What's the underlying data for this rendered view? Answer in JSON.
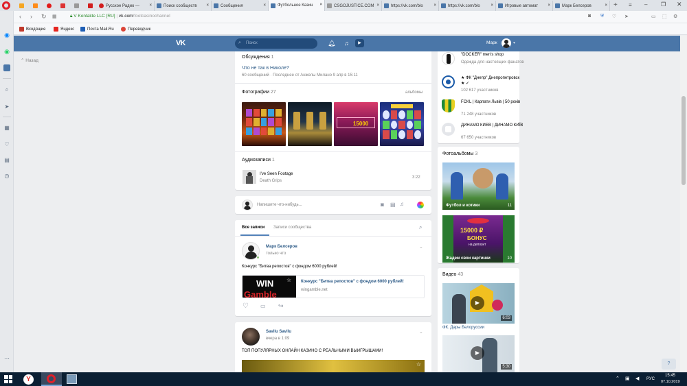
{
  "browser": {
    "tabs": [
      {
        "label": "Русское Радио —",
        "color": "#d21e1e"
      },
      {
        "label": "Поиск сообществ",
        "color": "#4a76a8"
      },
      {
        "label": "Сообщения",
        "color": "#4a76a8"
      },
      {
        "label": "Футбольное Казин",
        "color": "#4a76a8"
      },
      {
        "label": "CSGOJUSTICE.COM",
        "color": "#999999"
      },
      {
        "label": "https://vk.com/blo",
        "color": "#4a76a8"
      },
      {
        "label": "https://vk.com/blo",
        "color": "#4a76a8"
      },
      {
        "label": "Игровые автомат",
        "color": "#4a76a8"
      },
      {
        "label": "Марк Белсеров",
        "color": "#4a76a8"
      }
    ],
    "url_site": "V Kontakte LLC [RU]",
    "url_host": "vk.com",
    "url_path": "/footcasinochannel",
    "bookmarks": [
      {
        "label": "Входящие",
        "color": "#c0392b"
      },
      {
        "label": "Яндекс",
        "color": "#e52620"
      },
      {
        "label": "Почта Mail.Ru",
        "color": "#1f5fb5"
      },
      {
        "label": "Переводчик",
        "color": "#db4437"
      }
    ]
  },
  "vk": {
    "search_placeholder": "Поиск",
    "user_name": "Марк",
    "back_label": "Назад"
  },
  "discussions": {
    "title": "Обсуждения",
    "count": "1",
    "topic": "Что не так в Николе?",
    "meta": "60 сообщений · Последнее от Анжелы Милано 9 апр в 15:11"
  },
  "photos": {
    "title": "Фотографии",
    "count": "27",
    "albums_link": "альбомы",
    "banner_text": "15000"
  },
  "audio": {
    "title": "Аудиозаписи",
    "count": "1",
    "track": "I've Seen Footage",
    "artist": "Death Grips",
    "duration": "3:22"
  },
  "composer": {
    "placeholder": "Напишите что-нибудь..."
  },
  "wall_tabs": {
    "all": "Все записи",
    "community": "Записи сообщества"
  },
  "post1": {
    "author": "Марк Белсеров",
    "time": "только что",
    "text": "Конкурс \"Битва репостов\" с фондом 6000 рублей!",
    "link_title": "Конкурс \"Битва репостов\" с фондом 6000 рублей!",
    "link_host": "wingamble.net",
    "thumb_line1": "WIN",
    "thumb_line2": "Gamble"
  },
  "post2": {
    "author": "Savilu Savilu",
    "time": "вчера в 1:09",
    "text": "ТОП ПОПУЛЯРНЫХ ОНЛАЙН КАЗИНО С РЕАЛЬНЫМИ ВЫИГРЫШАМИ!"
  },
  "groups": [
    {
      "name": "\"DOCKER\" men's shop",
      "sub": "Одежда для настоящих фанатов",
      "members": ""
    },
    {
      "name": "★ ФК \"Днепр\" Днепропетровск ★ ✓",
      "sub": "",
      "members": "102 617 участников"
    },
    {
      "name": "FCKL | Карпати Львів | 50 років",
      "sub": "",
      "members": "71 248 участников"
    },
    {
      "name": "ДИНАМО КИЕВ | ДИНАМО КИЇВ",
      "sub": "",
      "members": "67 650 участников"
    }
  ],
  "photo_albums": {
    "title": "Фотоальбомы",
    "count": "3",
    "items": [
      {
        "caption": "Футбол и котики",
        "count": "11"
      },
      {
        "caption": "Жадем свои картинки",
        "count": "10"
      }
    ],
    "bonus_line1": "15000 ₽",
    "bonus_line2": "БОНУС",
    "bonus_line3": "на депозит"
  },
  "videos": {
    "title": "Видео",
    "count": "43",
    "items": [
      {
        "title": "ФК. Дары Белоруссии",
        "duration": "6:03"
      },
      {
        "title": "",
        "duration": "5:30"
      }
    ]
  },
  "help_button": "?",
  "taskbar": {
    "lang": "РУС",
    "time": "15:45",
    "date": "07.10.2019"
  },
  "colors": {
    "vk_blue": "#4a76a8",
    "link": "#2a5885",
    "page_bg": "#edeef0"
  }
}
